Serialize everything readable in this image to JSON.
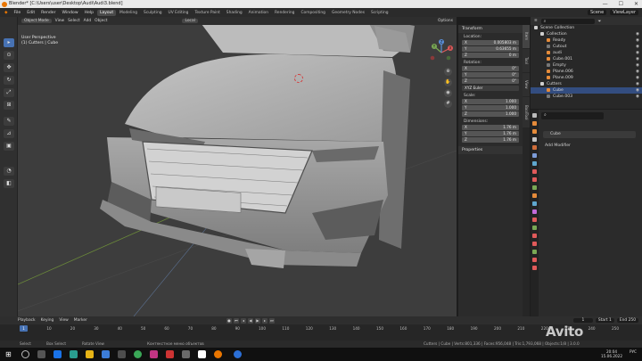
{
  "window": {
    "title": "Blender* [C:\\Users\\user\\Desktop\\Audi\\Audi3.blend]",
    "controls": [
      "—",
      "☐",
      "✕"
    ]
  },
  "menu": {
    "items": [
      "File",
      "Edit",
      "Render",
      "Window",
      "Help"
    ],
    "workspaces": [
      "Layout",
      "Modeling",
      "Sculpting",
      "UV Editing",
      "Texture Paint",
      "Shading",
      "Animation",
      "Rendering",
      "Compositing",
      "Geometry Nodes",
      "Scripting"
    ],
    "scene": "Scene",
    "view_layer": "ViewLayer"
  },
  "viewport": {
    "mode": "Object Mode",
    "menus": [
      "View",
      "Select",
      "Add",
      "Object"
    ],
    "transform": "Local",
    "info_line1": "User Perspective",
    "info_line2": "(1) Cutters | Cube",
    "options": "Options"
  },
  "gizmo": {
    "x": "X",
    "y": "Y",
    "z": "Z"
  },
  "npanel": {
    "title": "Transform",
    "location_label": "Location:",
    "location": [
      {
        "k": "X",
        "v": "0.005803 m"
      },
      {
        "k": "Y",
        "v": "0.63655 m"
      },
      {
        "k": "Z",
        "v": "0 m"
      }
    ],
    "rotation_label": "Rotation:",
    "rotation": [
      {
        "k": "X",
        "v": "0°"
      },
      {
        "k": "Y",
        "v": "0°"
      },
      {
        "k": "Z",
        "v": "0°"
      }
    ],
    "rotation_mode": "XYZ Euler",
    "scale_label": "Scale:",
    "scale": [
      {
        "k": "X",
        "v": "1.000"
      },
      {
        "k": "Y",
        "v": "1.000"
      },
      {
        "k": "Z",
        "v": "1.000"
      }
    ],
    "dimensions_label": "Dimensions:",
    "dimensions": [
      {
        "k": "X",
        "v": "1.76 m"
      },
      {
        "k": "Y",
        "v": "1.76 m"
      },
      {
        "k": "Z",
        "v": "1.76 m"
      }
    ],
    "properties_label": "Properties",
    "tabs": [
      "Item",
      "Tool",
      "View",
      "BoolTool"
    ]
  },
  "outliner": {
    "title": "Scene Collection",
    "rows": [
      {
        "label": "Collection",
        "indent": 1,
        "color": "#cfcfcf",
        "sel": false
      },
      {
        "label": "Ready",
        "indent": 2,
        "color": "#e58b3a",
        "sel": false
      },
      {
        "label": "Cutout",
        "indent": 2,
        "color": "#777",
        "sel": false
      },
      {
        "label": "audi",
        "indent": 2,
        "color": "#e58b3a",
        "sel": false
      },
      {
        "label": "Cube.001",
        "indent": 2,
        "color": "#e58b3a",
        "sel": false
      },
      {
        "label": "Empty",
        "indent": 2,
        "color": "#777",
        "sel": false
      },
      {
        "label": "Plane.006",
        "indent": 2,
        "color": "#e58b3a",
        "sel": false
      },
      {
        "label": "Plane.009",
        "indent": 2,
        "color": "#e58b3a",
        "sel": false
      },
      {
        "label": "Cutters",
        "indent": 1,
        "color": "#cfcfcf",
        "sel": false
      },
      {
        "label": "Cube",
        "indent": 2,
        "color": "#e58b3a",
        "sel": true
      },
      {
        "label": "Cube.003",
        "indent": 2,
        "color": "#777",
        "sel": false
      }
    ]
  },
  "properties": {
    "object_name": "Cube",
    "add_modifier": "Add Modifier",
    "side_icons": [
      "#bbbbbb",
      "#e58b3a",
      "#e58b3a",
      "#c4c4c4",
      "#cf6d3a",
      "#7c9cd8",
      "#5fa7ce",
      "#e05a5a",
      "#e05a5a",
      "#7aa855",
      "#e58b3a",
      "#5fa7ce",
      "#c26ad8",
      "#e05a5a",
      "#7aa855",
      "#e05a5a",
      "#e05a5a",
      "#7aa855",
      "#e05a5a",
      "#e05a5a"
    ]
  },
  "timeline": {
    "menus": [
      "Playback",
      "Keying",
      "View",
      "Marker"
    ],
    "current_frame": "1",
    "start_label": "Start",
    "start": "1",
    "end_label": "End",
    "end": "250",
    "ticks": [
      "0",
      "10",
      "20",
      "30",
      "40",
      "50",
      "60",
      "70",
      "80",
      "90",
      "100",
      "110",
      "120",
      "130",
      "140",
      "150",
      "160",
      "170",
      "180",
      "190",
      "200",
      "210",
      "220",
      "230",
      "240",
      "250"
    ]
  },
  "status": {
    "left": "Select",
    "middle": "Box Select",
    "right": "Rotate View",
    "context": "Контекстное меню объектов",
    "stats": "Cutters | Cube | Verts:801,336 | Faces:956,048 | Tris:1,793,068 | Objects:1/8 | 3.0.0"
  },
  "taskbar": {
    "lang": "РУС",
    "time": "20:04",
    "date": "15.06.2022"
  },
  "watermark": "Avito"
}
